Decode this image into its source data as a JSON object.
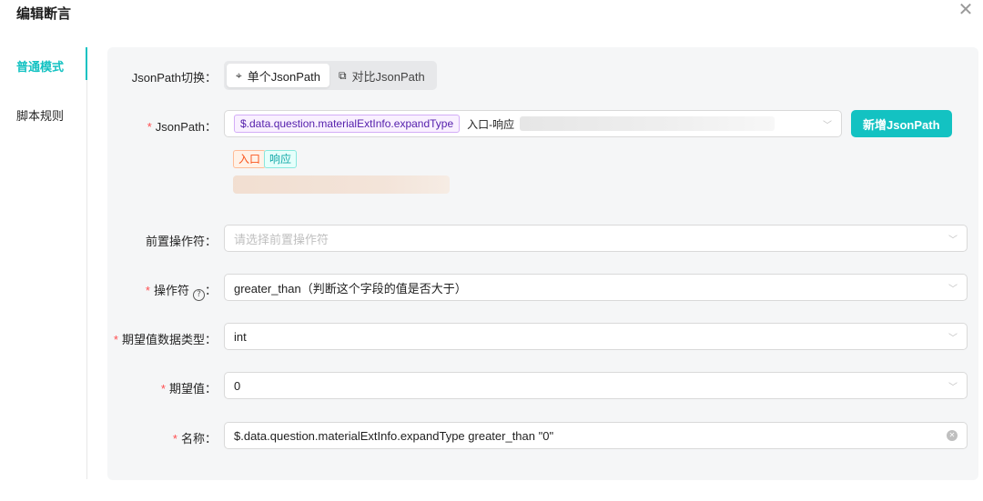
{
  "dialog": {
    "title": "编辑断言",
    "close_icon": "close-icon"
  },
  "side_nav": {
    "items": [
      {
        "label": "普通模式",
        "active": true
      },
      {
        "label": "脚本规则",
        "active": false
      }
    ]
  },
  "form": {
    "mode_switch": {
      "label": "JsonPath切换",
      "options": [
        {
          "label": "单个JsonPath",
          "icon": "crosshair-icon",
          "active": true
        },
        {
          "label": "对比JsonPath",
          "icon": "compare-icon",
          "active": false
        }
      ]
    },
    "jsonpath": {
      "label": "JsonPath",
      "required": true,
      "tag_value": "$.data.question.materialExtInfo.expandType",
      "extra_text": "入口-响应",
      "add_button": "新增JsonPath",
      "source_tags": [
        "入口",
        "响应"
      ]
    },
    "pre_operator": {
      "label": "前置操作符",
      "required": false,
      "placeholder": "请选择前置操作符"
    },
    "operator": {
      "label": "操作符",
      "required": true,
      "help_icon": "question-icon",
      "value": "greater_than（判断这个字段的值是否大于）"
    },
    "expected_type": {
      "label": "期望值数据类型",
      "required": true,
      "value": "int"
    },
    "expected_value": {
      "label": "期望值",
      "required": true,
      "value": "0"
    },
    "name": {
      "label": "名称",
      "required": true,
      "value": "$.data.question.materialExtInfo.expandType greater_than \"0\""
    }
  },
  "colors": {
    "accent": "#13c2c2",
    "required": "#ff4d4f",
    "panel_bg": "#f5f6f7"
  }
}
